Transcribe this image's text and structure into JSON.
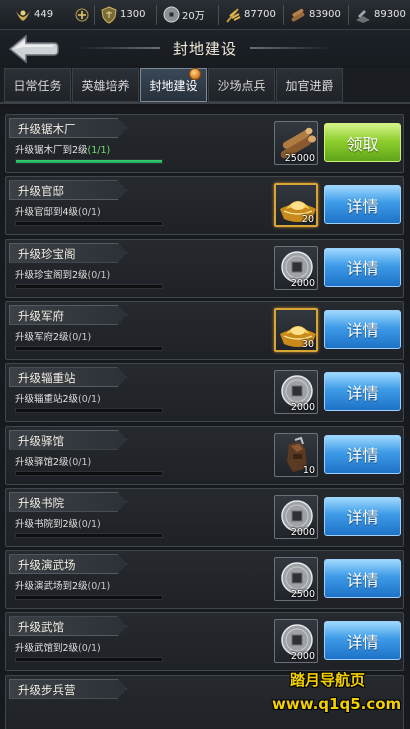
{
  "resources": [
    {
      "icon": "laurel-icon",
      "value": "449"
    },
    {
      "icon": "add-icon",
      "value": ""
    },
    {
      "icon": "shield-icon",
      "value": "1300"
    },
    {
      "icon": "coin-icon",
      "value": "20万"
    },
    {
      "icon": "grain-icon",
      "value": "87700"
    },
    {
      "icon": "wood-icon",
      "value": "83900"
    },
    {
      "icon": "iron-icon",
      "value": "89300"
    }
  ],
  "header": {
    "title": "封地建设"
  },
  "tabs": [
    {
      "label": "日常任务"
    },
    {
      "label": "英雄培养"
    },
    {
      "label": "封地建设",
      "active": true
    },
    {
      "label": "沙场点兵"
    },
    {
      "label": "加官进爵"
    }
  ],
  "tasks": [
    {
      "title": "升级锯木厂",
      "desc": "升级锯木厂到2级",
      "progress": "(1/1)",
      "done": true,
      "progress_fraction": 1,
      "reward_icon": "lumber-icon",
      "reward_qty": "25000",
      "button": "领取",
      "button_style": "green"
    },
    {
      "title": "升级官邸",
      "desc": "升级官邸到4级",
      "progress": "(0/1)",
      "done": false,
      "progress_fraction": 0,
      "reward_icon": "gold-ingot-icon",
      "reward_qty": "20",
      "button": "详情",
      "button_style": "blue"
    },
    {
      "title": "升级珍宝阁",
      "desc": "升级珍宝阁到2级",
      "progress": "(0/1)",
      "done": false,
      "progress_fraction": 0,
      "reward_icon": "silver-coin-icon",
      "reward_qty": "2000",
      "button": "详情",
      "button_style": "blue"
    },
    {
      "title": "升级军府",
      "desc": "升级军府2级",
      "progress": "(0/1)",
      "done": false,
      "progress_fraction": 0,
      "reward_icon": "gold-ingot-icon",
      "reward_qty": "30",
      "button": "详情",
      "button_style": "blue"
    },
    {
      "title": "升级辎重站",
      "desc": "升级辎重站2级",
      "progress": "(0/1)",
      "done": false,
      "progress_fraction": 0,
      "reward_icon": "silver-coin-icon",
      "reward_qty": "2000",
      "button": "详情",
      "button_style": "blue"
    },
    {
      "title": "升级驿馆",
      "desc": "升级驿馆2级",
      "progress": "(0/1)",
      "done": false,
      "progress_fraction": 0,
      "reward_icon": "leather-bag-icon",
      "reward_qty": "10",
      "button": "详情",
      "button_style": "blue"
    },
    {
      "title": "升级书院",
      "desc": "升级书院到2级",
      "progress": "(0/1)",
      "done": false,
      "progress_fraction": 0,
      "reward_icon": "silver-coin-icon",
      "reward_qty": "2000",
      "button": "详情",
      "button_style": "blue"
    },
    {
      "title": "升级演武场",
      "desc": "升级演武场到2级",
      "progress": "(0/1)",
      "done": false,
      "progress_fraction": 0,
      "reward_icon": "silver-coin-icon",
      "reward_qty": "2500",
      "button": "详情",
      "button_style": "blue"
    },
    {
      "title": "升级武馆",
      "desc": "升级武馆到2级",
      "progress": "(0/1)",
      "done": false,
      "progress_fraction": 0,
      "reward_icon": "silver-coin-icon",
      "reward_qty": "2000",
      "button": "详情",
      "button_style": "blue"
    },
    {
      "title": "升级步兵营",
      "desc": "",
      "progress": "",
      "done": false,
      "progress_fraction": 0,
      "reward_icon": "",
      "reward_qty": "",
      "button": "",
      "button_style": "blue"
    }
  ],
  "watermark": {
    "line1": "踏月导航页",
    "line2": "www.q1q5.com"
  }
}
